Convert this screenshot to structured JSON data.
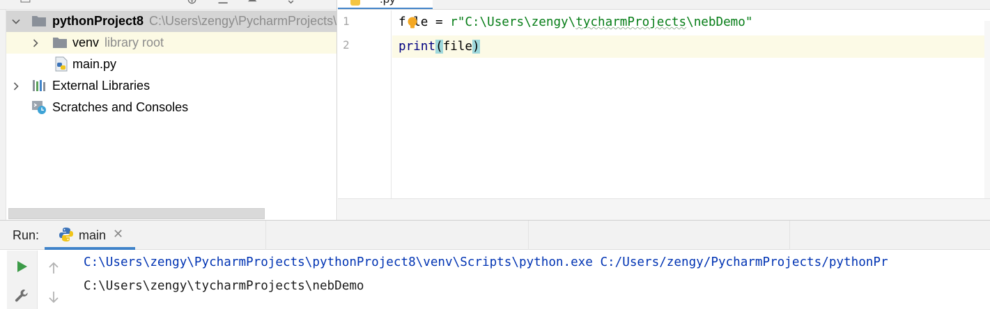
{
  "project_tree": {
    "items": [
      {
        "label": "pythonProject8",
        "secondary": "C:\\Users\\zengy\\PycharmProjects\\",
        "expanded": true,
        "icon": "folder-icon"
      },
      {
        "label": "venv",
        "secondary": "library root",
        "expanded": false,
        "icon": "folder-icon"
      },
      {
        "label": "main.py",
        "secondary": "",
        "icon": "python-file-icon"
      },
      {
        "label": "External Libraries",
        "secondary": "",
        "expanded": false,
        "icon": "libraries-icon"
      },
      {
        "label": "Scratches and Consoles",
        "secondary": "",
        "icon": "scratches-icon"
      }
    ]
  },
  "editor": {
    "line_numbers": [
      "1",
      "2"
    ],
    "line1": {
      "var_a": "f",
      "var_b": "le",
      "assign": " = ",
      "prefix": "r",
      "string_a": "\"C:\\Users\\zengy\\",
      "string_b": "tycharmProjects",
      "string_c": "\\nebDemo\""
    },
    "line2": {
      "func": "print",
      "paren_open": "(",
      "arg": "file",
      "paren_close": ")"
    },
    "colors": {
      "string": "#067d17",
      "builtin": "#000080",
      "paren_highlight": "#9ed8dc",
      "current_line": "#fcfae6"
    }
  },
  "run_panel": {
    "label": "Run:",
    "tab_label": "main",
    "console": {
      "command_line": "C:\\Users\\zengy\\PycharmProjects\\pythonProject8\\venv\\Scripts\\python.exe C:/Users/zengy/PycharmProjects/pythonPr",
      "output_line": "C:\\Users\\zengy\\tycharmProjects\\nebDemo"
    },
    "colors": {
      "command": "#0033b3",
      "output": "#1a1a1a",
      "accent": "#4083c9"
    }
  }
}
